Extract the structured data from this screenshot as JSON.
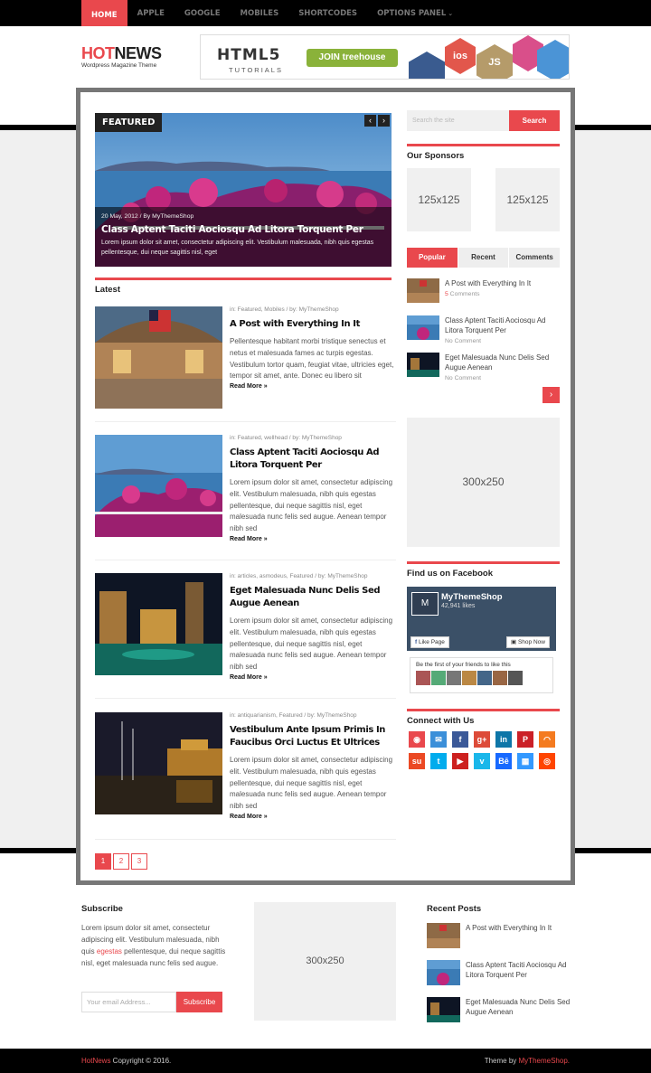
{
  "nav": {
    "items": [
      "HOME",
      "APPLE",
      "GOOGLE",
      "MOBILES",
      "SHORTCODES",
      "OPTIONS PANEL"
    ],
    "active": "HOME",
    "caret_icon": "chevron-down-icon"
  },
  "header": {
    "logo_hot": "HOT",
    "logo_news": "NEWS",
    "tagline": "Wordpress Magazine Theme",
    "banner": {
      "title": "HTML5",
      "subtitle": "TUTORIALS",
      "button": "JOIN treehouse",
      "hex_labels": [
        "ios",
        "JS"
      ]
    }
  },
  "featured": {
    "label": "FEATURED",
    "meta": "20 May, 2012 / By MyThemeShop",
    "title": "Class Aptent Taciti Aociosqu Ad Litora Torquent Per",
    "excerpt": "Lorem ipsum dolor sit amet, consectetur adipiscing elit. Vestibulum malesuada, nibh quis egestas pellentesque, dui neque sagittis nisl, eget",
    "prev": "‹",
    "next": "›"
  },
  "latest": {
    "heading": "Latest",
    "posts": [
      {
        "meta": "in: Featured, Mobiles / by: MyThemeShop",
        "title": "A Post with Everything In It",
        "excerpt": "Pellentesque habitant morbi tristique senectus et netus et malesuada fames ac turpis egestas. Vestibulum tortor quam, feugiat vitae, ultricies eget, tempor sit amet, ante. Donec eu libero sit",
        "more": "Read More »"
      },
      {
        "meta": "in: Featured, wellhead / by: MyThemeShop",
        "title": "Class Aptent Taciti Aociosqu Ad Litora Torquent Per",
        "excerpt": "Lorem ipsum dolor sit amet, consectetur adipiscing elit. Vestibulum malesuada, nibh quis egestas pellentesque, dui neque sagittis nisl, eget malesuada nunc felis sed augue. Aenean tempor nibh sed",
        "more": "Read More »"
      },
      {
        "meta": "in: articles, asmodeus, Featured / by: MyThemeShop",
        "title": "Eget Malesuada Nunc Delis Sed Augue Aenean",
        "excerpt": "Lorem ipsum dolor sit amet, consectetur adipiscing elit. Vestibulum malesuada, nibh quis egestas pellentesque, dui neque sagittis nisl, eget malesuada nunc felis sed augue. Aenean tempor nibh sed",
        "more": "Read More »"
      },
      {
        "meta": "in: antiquarianism, Featured / by: MyThemeShop",
        "title": "Vestibulum Ante Ipsum Primis In Faucibus Orci Luctus Et Ultrices",
        "excerpt": "Lorem ipsum dolor sit amet, consectetur adipiscing elit. Vestibulum malesuada, nibh quis egestas pellentesque, dui neque sagittis nisl, eget malesuada nunc felis sed augue. Aenean tempor nibh sed",
        "more": "Read More »"
      }
    ]
  },
  "pagination": [
    "1",
    "2",
    "3"
  ],
  "sidebar": {
    "search_placeholder": "Search the site",
    "search_button": "Search",
    "sponsors_heading": "Our Sponsors",
    "ad_small": "125x125",
    "tabs": [
      "Popular",
      "Recent",
      "Comments"
    ],
    "tab_posts": [
      {
        "title": "A Post with Everything In It",
        "count": "5",
        "comments": " Comments"
      },
      {
        "title": "Class Aptent Taciti Aociosqu Ad Litora Torquent Per",
        "comments": "No Comment"
      },
      {
        "title": "Eget Malesuada Nunc Delis Sed Augue Aenean",
        "comments": "No Comment"
      }
    ],
    "next_arrow": "›",
    "ad_large": "300x250",
    "facebook_heading": "Find us on Facebook",
    "facebook": {
      "page_name": "MyThemeShop",
      "likes": "42,941 likes",
      "like_button": "Like Page",
      "shop_button": "Shop Now",
      "friends_text": "Be the first of your friends to like this"
    },
    "connect_heading": "Connect with Us",
    "social_icons": [
      "dribbble-icon",
      "email-icon",
      "facebook-icon",
      "google-plus-icon",
      "linkedin-icon",
      "pinterest-icon",
      "rss-icon",
      "stumbleupon-icon",
      "twitter-icon",
      "youtube-icon",
      "vimeo-icon",
      "behance-icon",
      "delicious-icon",
      "reddit-icon"
    ],
    "social_glyphs": [
      "◉",
      "✉",
      "f",
      "g+",
      "in",
      "P",
      "◠",
      "su",
      "t",
      "▶",
      "v",
      "Bē",
      "▦",
      "◎"
    ],
    "social_colors": [
      "#e9484d",
      "#3b8fd9",
      "#3b5998",
      "#dd4b39",
      "#0e76a8",
      "#cb2027",
      "#f47b20",
      "#eb4924",
      "#00aced",
      "#cd201f",
      "#1ab7ea",
      "#1769ff",
      "#3399ff",
      "#ff4500"
    ]
  },
  "footer": {
    "subscribe_heading": "Subscribe",
    "subscribe_text_a": "Lorem ipsum dolor sit amet, consectetur adipiscing elit. Vestibulum malesuada, nibh quis ",
    "subscribe_text_red": "egestas",
    "subscribe_text_b": " pellentesque, dui neque sagittis nisl, eget malesuada nunc felis sed augue.",
    "email_placeholder": "Your email Address...",
    "subscribe_button": "Subscribe",
    "ad": "300x250",
    "recent_heading": "Recent Posts",
    "recent": [
      "A Post with Everything In It",
      "Class Aptent Taciti Aociosqu Ad Litora Torquent Per",
      "Eget Malesuada Nunc Delis Sed Augue Aenean"
    ]
  },
  "bottombar": {
    "brand": "HotNews",
    "copyright": " Copyright © 2016.",
    "theme_by": "Theme by ",
    "theme_link": "MyThemeShop",
    "dot": "."
  },
  "colors": {
    "accent": "#e9484d",
    "black": "#000000",
    "frame": "#777777"
  }
}
